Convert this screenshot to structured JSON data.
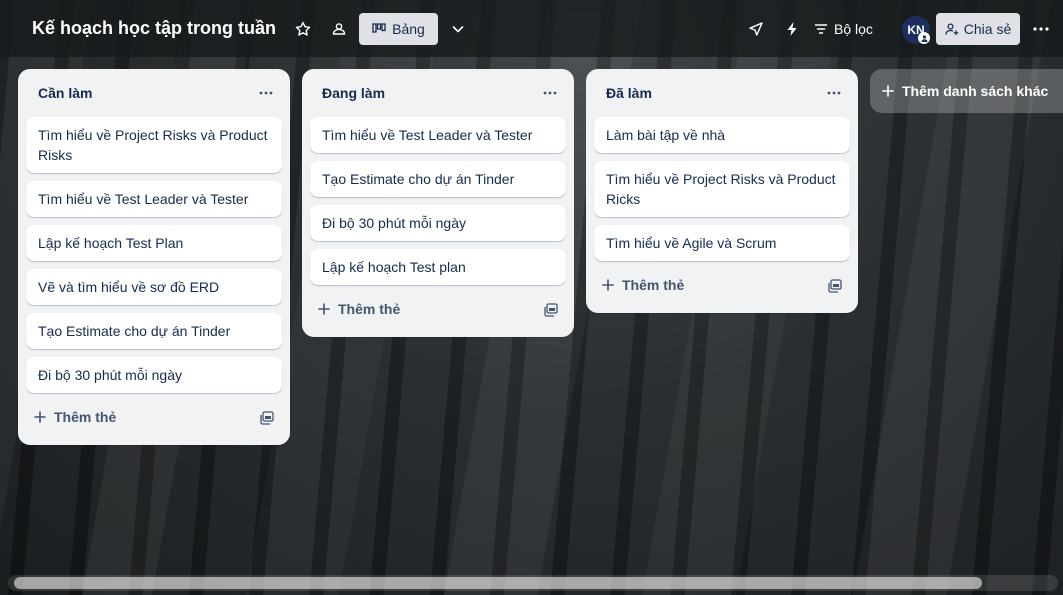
{
  "board": {
    "title": "Kế hoạch học tập trong tuần",
    "view_label": "Bảng",
    "filter_label": "Bộ lọc",
    "share_label": "Chia sẻ",
    "avatar_initials": "KN"
  },
  "lists": [
    {
      "title": "Cần làm",
      "cards": [
        "Tìm hiểu về Project Risks và Product Risks",
        "Tìm hiểu về Test Leader và Tester",
        "Lập kế hoạch Test Plan",
        "Vẽ và tìm hiểu về sơ đồ ERD",
        "Tạo Estimate cho dự án Tinder",
        "Đi bộ 30 phút mỗi ngày"
      ],
      "add_card_label": "Thêm thẻ"
    },
    {
      "title": "Đang làm",
      "cards": [
        "Tìm hiểu về Test Leader và Tester",
        "Tạo Estimate cho dự án Tinder",
        "Đi bộ 30 phút mỗi ngày",
        "Lập kế hoạch Test plan"
      ],
      "add_card_label": "Thêm thẻ"
    },
    {
      "title": "Đã làm",
      "cards": [
        "Làm bài tập về nhà",
        "Tìm hiểu về Project Risks và Product Ricks",
        "Tìm hiểu về Agile và Scrum"
      ],
      "add_card_label": "Thêm thẻ"
    }
  ],
  "add_list_label": "Thêm danh sách khác",
  "icons": {
    "star": "star-icon",
    "workspace": "workspace-visibility-icon",
    "board_view": "board-view-icon",
    "chevron": "chevron-down-icon",
    "rocket": "power-ups-icon",
    "automation": "lightning-icon",
    "filter": "filter-icon",
    "share": "add-person-icon",
    "more": "more-horizontal-icon",
    "plus": "plus-icon",
    "template": "template-icon"
  },
  "colors": {
    "list_bg": "#f1f2f4",
    "card_bg": "#ffffff",
    "text": "#172b4d",
    "button_bg": "#dfe1e6",
    "avatar_bg": "#1d2f5e"
  }
}
